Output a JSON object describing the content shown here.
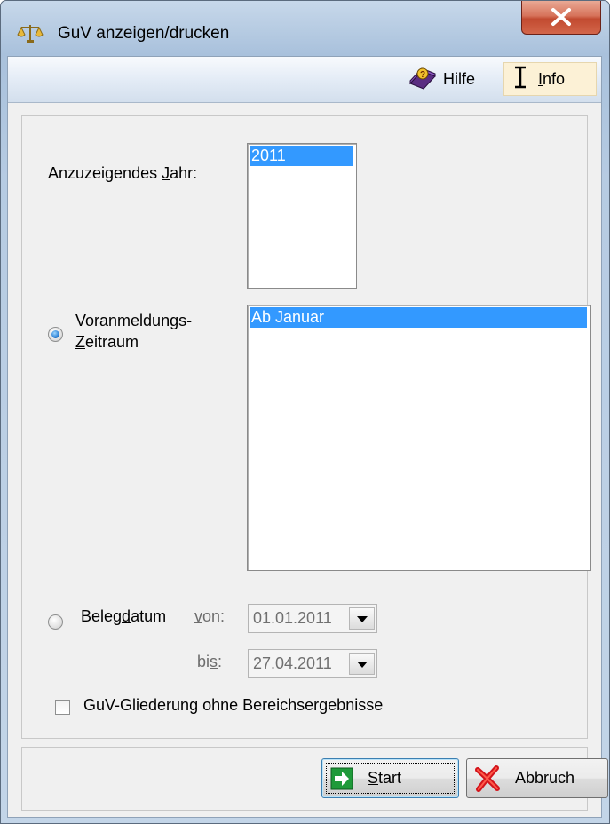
{
  "window": {
    "title": "GuV anzeigen/drucken",
    "icon": "scales-icon",
    "close_icon": "close-icon"
  },
  "toolbar": {
    "help_label": "Hilfe",
    "info_label": "Info",
    "info_mnemonic": "I",
    "info_rest": "nfo"
  },
  "form": {
    "year_label_pre": "Anzuzeigendes ",
    "year_label_mnemonic": "J",
    "year_label_post": "ahr:",
    "year_options": [
      "2011"
    ],
    "year_selected": "2011",
    "period_radio_line1": "Voranmeldungs-",
    "period_radio_line2_mnemonic": "Z",
    "period_radio_line2_rest": "eitraum",
    "period_selected": true,
    "period_options": [
      "Ab Januar"
    ],
    "period_selected_value": "Ab Januar",
    "belegdatum_pre": "Beleg",
    "belegdatum_mnemonic": "d",
    "belegdatum_post": "atum",
    "belegdatum_selected": false,
    "from_label_mnemonic": "v",
    "from_label_rest": "on:",
    "from_value": "01.01.2011",
    "to_label_pre": "bi",
    "to_label_mnemonic": "s",
    "to_label_post": ":",
    "to_value": "27.04.2011",
    "checkbox_label": "GuV-Gliederung ohne Bereichsergebnisse",
    "checkbox_checked": false
  },
  "buttons": {
    "start_mnemonic": "S",
    "start_rest": "tart",
    "cancel_label": "Abbruch"
  },
  "colors": {
    "selection": "#3399ff",
    "close_red": "#c24a30"
  }
}
